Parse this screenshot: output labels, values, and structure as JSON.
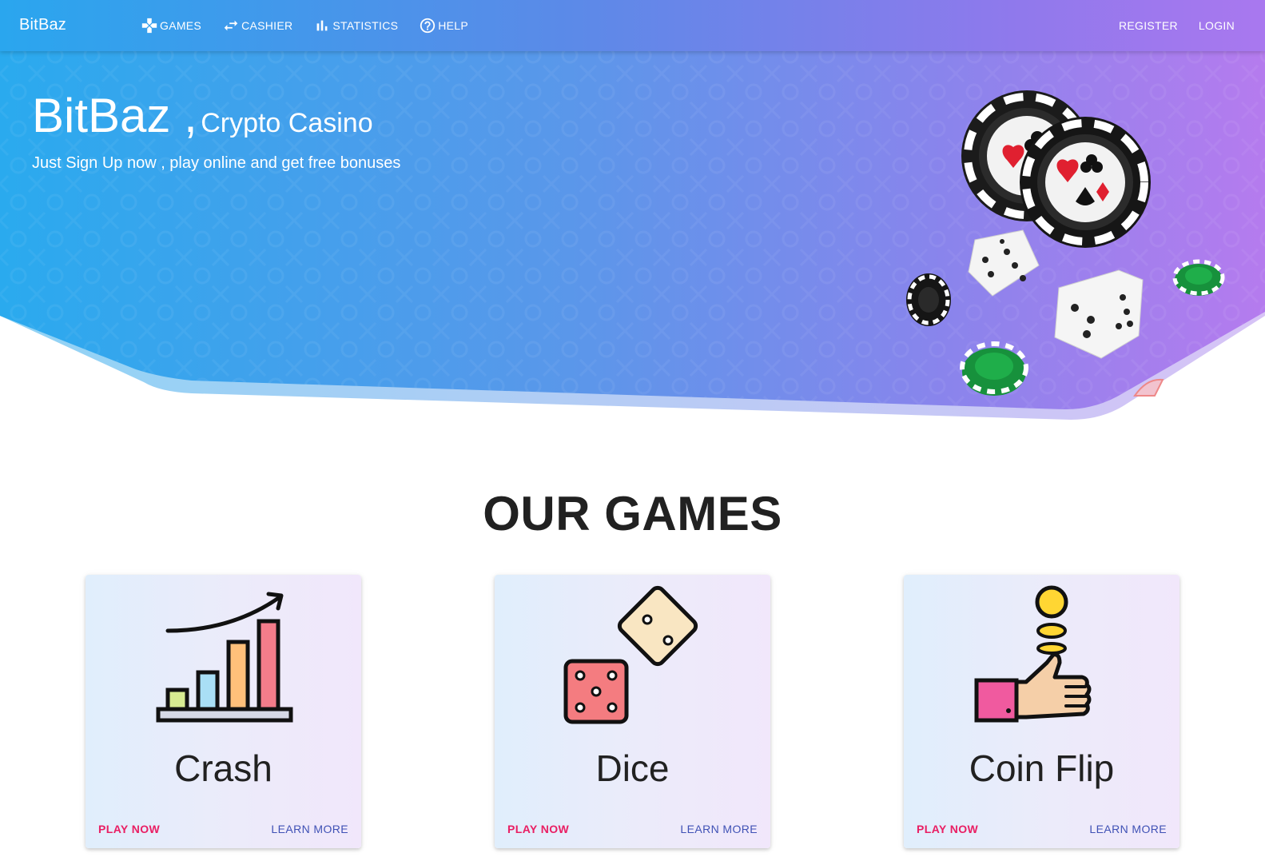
{
  "colors": {
    "accent_play": "#e91e63",
    "accent_learn": "#3f51b5",
    "hero_gradient_start": "#2aa6ee",
    "hero_gradient_end": "#b57bee"
  },
  "navbar": {
    "brand": "BitBaz",
    "links": [
      {
        "label": "GAMES",
        "icon": "gamepad-icon"
      },
      {
        "label": "CASHIER",
        "icon": "swap-arrows-icon"
      },
      {
        "label": "STATISTICS",
        "icon": "bar-chart-icon"
      },
      {
        "label": "HELP",
        "icon": "help-circle-icon"
      }
    ],
    "right": {
      "register": "REGISTER",
      "login": "LOGIN"
    }
  },
  "hero": {
    "title": "BitBaz ,",
    "subtitle_inline": "Crypto Casino",
    "tagline": "Just Sign Up now , play online and get free bonuses"
  },
  "games_section": {
    "title": "OUR GAMES",
    "cards": [
      {
        "name": "Crash",
        "icon": "growth-chart-icon",
        "play": "PLAY NOW",
        "learn": "LEARN MORE"
      },
      {
        "name": "Dice",
        "icon": "dice-icon",
        "play": "PLAY NOW",
        "learn": "LEARN MORE"
      },
      {
        "name": "Coin Flip",
        "icon": "coin-flip-icon",
        "play": "PLAY NOW",
        "learn": "LEARN MORE"
      }
    ]
  }
}
